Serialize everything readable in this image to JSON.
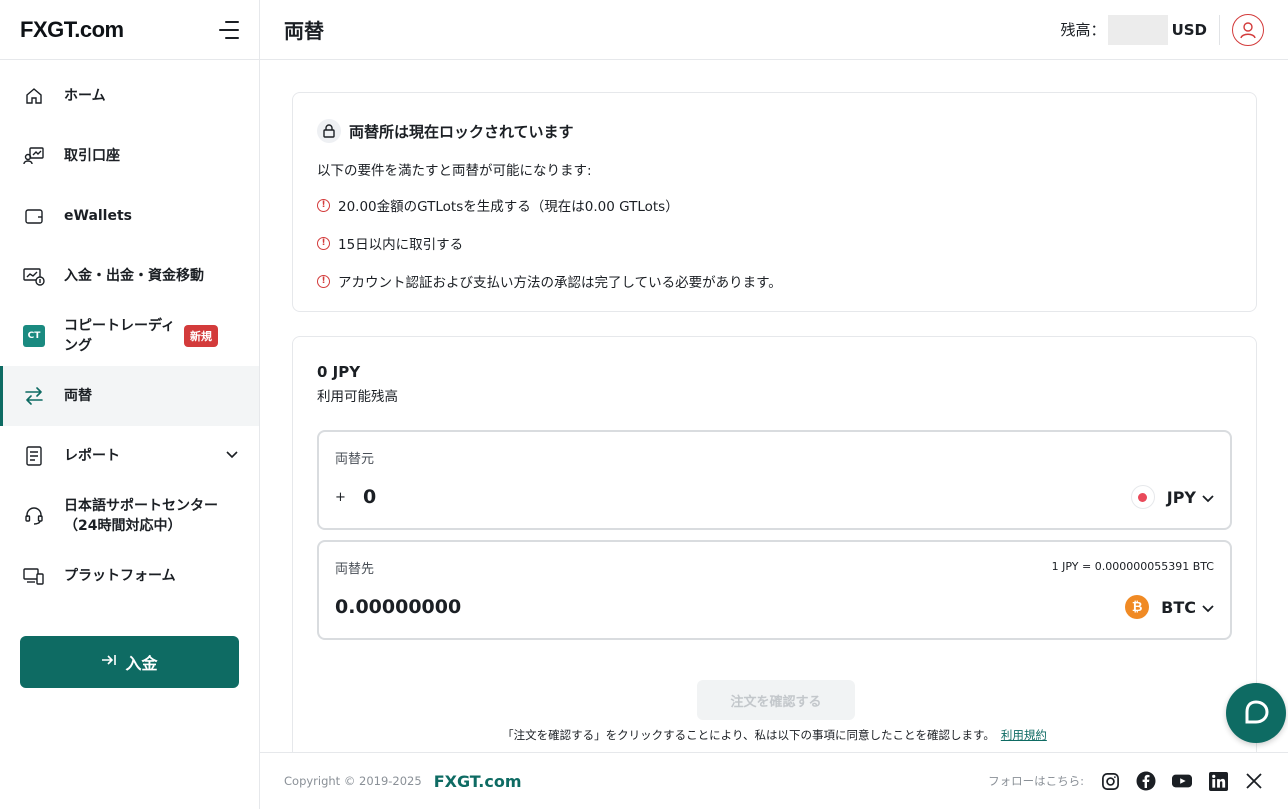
{
  "sidebar": {
    "logo": "FXGT.com",
    "items": [
      {
        "label": "ホーム"
      },
      {
        "label": "取引口座"
      },
      {
        "label": "eWallets"
      },
      {
        "label": "入金・出金・資金移動"
      },
      {
        "label": "コピートレーディング",
        "badge": "新規",
        "icon_text": "CT"
      },
      {
        "label": "両替"
      },
      {
        "label": "レポート"
      },
      {
        "label": "日本語サポートセンター（24時間対応中）"
      },
      {
        "label": "プラットフォーム"
      }
    ],
    "deposit_label": "入金"
  },
  "header": {
    "title": "両替",
    "balance_label": "残高：",
    "balance_currency": "USD"
  },
  "lock": {
    "title": "両替所は現在ロックされています",
    "intro": "以下の要件を満たすと両替が可能になります:",
    "requirements": [
      "20.00金額のGTLotsを生成する（現在は0.00 GTLots）",
      "15日以内に取引する",
      "アカウント認証および支払い方法の承認は完了している必要があります。"
    ]
  },
  "exchange": {
    "available_amount": "0 JPY",
    "available_label": "利用可能残高",
    "from_label": "両替元",
    "from_value": "0",
    "from_currency": "JPY",
    "to_label": "両替先",
    "to_value": "0.00000000",
    "to_currency": "BTC",
    "rate": "1 JPY = 0.000000055391 BTC",
    "confirm_label": "注文を確認する",
    "consent_text": "「注文を確認する」をクリックすることにより、私は以下の事項に同意したことを確認します。",
    "terms_link": "利用規約"
  },
  "footer": {
    "copyright": "Copyright © 2019-2025",
    "logo": "FXGT.com",
    "follow": "フォローはこちら:"
  },
  "colors": {
    "brand": "#0e6b63",
    "alert": "#d33b3b",
    "btc": "#f08a24"
  }
}
